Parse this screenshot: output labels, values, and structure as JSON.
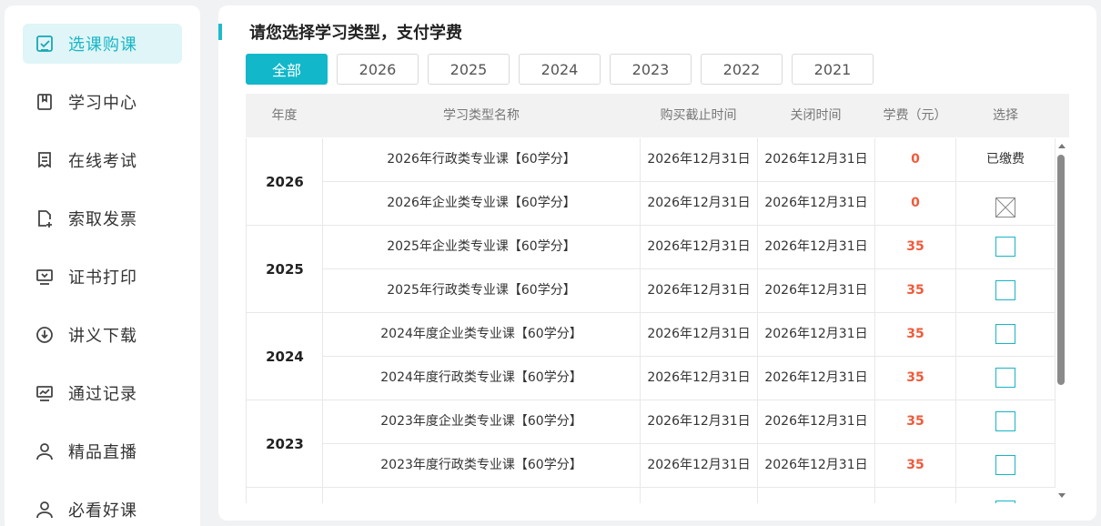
{
  "sidebar": {
    "items": [
      {
        "label": "选课购课",
        "icon": "cart-check-icon",
        "active": true
      },
      {
        "label": "学习中心",
        "icon": "book-icon"
      },
      {
        "label": "在线考试",
        "icon": "exam-icon"
      },
      {
        "label": "索取发票",
        "icon": "invoice-add-icon"
      },
      {
        "label": "证书打印",
        "icon": "certificate-icon"
      },
      {
        "label": "讲义下载",
        "icon": "download-icon"
      },
      {
        "label": "通过记录",
        "icon": "chart-record-icon"
      },
      {
        "label": "精品直播",
        "icon": "user-live-icon"
      },
      {
        "label": "必看好课",
        "icon": "user-course-icon"
      }
    ]
  },
  "main": {
    "title": "请您选择学习类型，支付学费",
    "tabs": [
      "全部",
      "2026",
      "2025",
      "2024",
      "2023",
      "2022",
      "2021"
    ],
    "active_tab": "全部"
  },
  "table": {
    "headers": [
      "年度",
      "学习类型名称",
      "购买截止时间",
      "关闭时间",
      "学费（元）",
      "选择"
    ],
    "groups": [
      {
        "year": "2026",
        "rows": [
          {
            "name": "2026年行政类专业课【60学分】",
            "deadline": "2026年12月31日",
            "close": "2026年12月31日",
            "fee": "0",
            "select": "已缴费"
          },
          {
            "name": "2026年企业类专业课【60学分】",
            "deadline": "2026年12月31日",
            "close": "2026年12月31日",
            "fee": "0",
            "select": "disabled"
          }
        ]
      },
      {
        "year": "2025",
        "rows": [
          {
            "name": "2025年企业类专业课【60学分】",
            "deadline": "2026年12月31日",
            "close": "2026年12月31日",
            "fee": "35",
            "select": "checkbox"
          },
          {
            "name": "2025年行政类专业课【60学分】",
            "deadline": "2026年12月31日",
            "close": "2026年12月31日",
            "fee": "35",
            "select": "checkbox"
          }
        ]
      },
      {
        "year": "2024",
        "rows": [
          {
            "name": "2024年度企业类专业课【60学分】",
            "deadline": "2026年12月31日",
            "close": "2026年12月31日",
            "fee": "35",
            "select": "checkbox"
          },
          {
            "name": "2024年度行政类专业课【60学分】",
            "deadline": "2026年12月31日",
            "close": "2026年12月31日",
            "fee": "35",
            "select": "checkbox"
          }
        ]
      },
      {
        "year": "2023",
        "rows": [
          {
            "name": "2023年度企业类专业课【60学分】",
            "deadline": "2026年12月31日",
            "close": "2026年12月31日",
            "fee": "35",
            "select": "checkbox"
          },
          {
            "name": "2023年度行政类专业课【60学分】",
            "deadline": "2026年12月31日",
            "close": "2026年12月31日",
            "fee": "35",
            "select": "checkbox"
          }
        ]
      }
    ]
  },
  "colors": {
    "accent": "#12b8c9",
    "fee": "#ee5b3b",
    "active_bg": "#dff5f7"
  }
}
